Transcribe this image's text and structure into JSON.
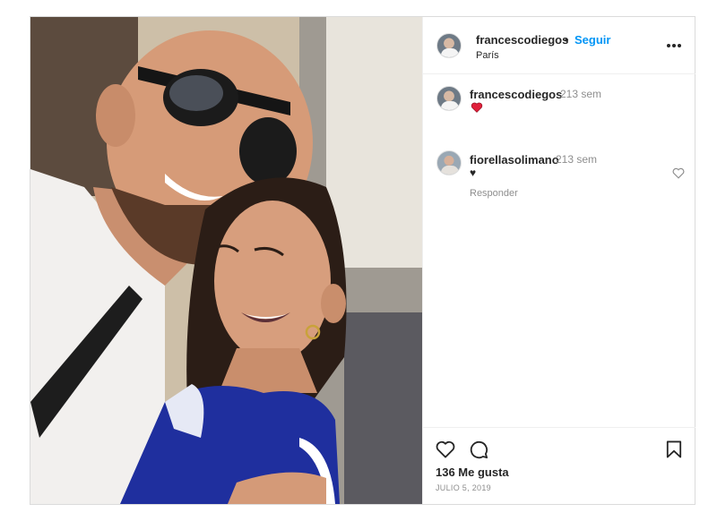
{
  "post": {
    "author": "francescodiegos",
    "follow_label": "Seguir",
    "separator": "•",
    "location": "París"
  },
  "caption": {
    "username": "francescodiegos",
    "time": "213 sem",
    "text_icon": "red-heart-emoji"
  },
  "comments": [
    {
      "username": "fiorellasolimano",
      "time": "213 sem",
      "text": "♥",
      "reply_label": "Responder"
    }
  ],
  "actions": {
    "likes": "136 Me gusta",
    "date": "JULIO 5, 2019"
  },
  "colors": {
    "accent": "#0095f6",
    "text": "#262626",
    "muted": "#8e8e8e",
    "border": "#dbdbdb",
    "heart_red": "#ed4956"
  }
}
